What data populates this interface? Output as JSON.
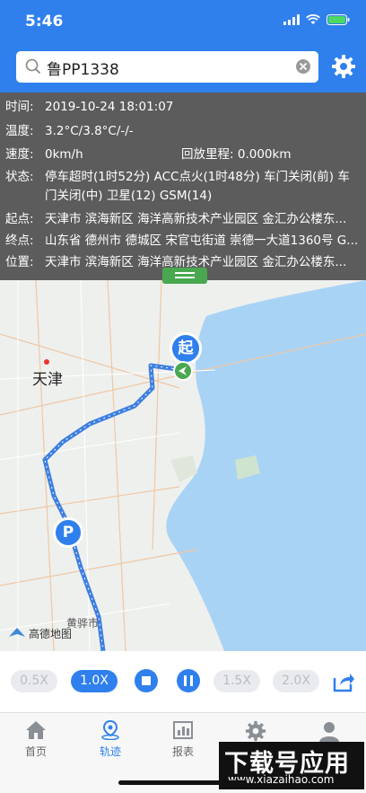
{
  "status_bar": {
    "time": "5:46"
  },
  "search": {
    "value": "鲁PP1338"
  },
  "info": {
    "time_label": "时间:",
    "time_value": "2019-10-24 18:01:07",
    "temp_label": "温度:",
    "temp_value": "3.2°C/3.8°C/-/-",
    "speed_label": "速度:",
    "speed_value": "0km/h",
    "mileage_label": "回放里程:",
    "mileage_value": "0.000km",
    "state_label": "状态:",
    "state_line1": "停车超时(1时52分) ACC点火(1时48分) 车门关闭(前) 车",
    "state_line2": "门关闭(中) 卫星(12) GSM(14)",
    "start_label": "起点:",
    "start_value": "天津市 滨海新区 海洋高新技术产业园区 金汇办公楼东...",
    "end_label": "终点:",
    "end_value": "山东省 德州市 德城区 宋官屯街道 崇德一大道1360号 G...",
    "pos_label": "位置:",
    "pos_value": "天津市 滨海新区 海洋高新技术产业园区 金汇办公楼东..."
  },
  "map": {
    "city_label": "天津",
    "town_label": "黄骅市",
    "logo_text": "高德地图",
    "start_marker": "起",
    "parking_marker": "P"
  },
  "controls": {
    "speeds": [
      "0.5X",
      "1.0X",
      "1.5X",
      "2.0X"
    ],
    "active_speed": "1.0X"
  },
  "tabs": [
    {
      "label": "首页",
      "icon": "home-icon"
    },
    {
      "label": "轨迹",
      "icon": "track-icon"
    },
    {
      "label": "报表",
      "icon": "report-icon"
    },
    {
      "label": "",
      "icon": "settings-icon"
    },
    {
      "label": "",
      "icon": "user-icon"
    }
  ],
  "watermark": {
    "main": "下载号应用",
    "sub": "www.xiazaihao.com"
  },
  "colors": {
    "primary": "#2f80ed",
    "route": "#3d7fe0",
    "start_green": "#49a84f"
  }
}
